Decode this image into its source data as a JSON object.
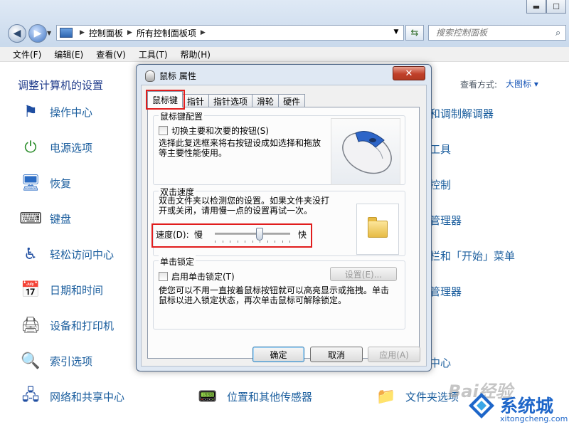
{
  "window": {
    "address": {
      "segments": [
        "控制面板",
        "所有控制面板项"
      ]
    },
    "search": {
      "placeholder": "搜索控制面板"
    },
    "caption": {
      "minimize": "▬",
      "maximize": "☐"
    }
  },
  "menu": [
    "文件(F)",
    "编辑(E)",
    "查看(V)",
    "工具(T)",
    "帮助(H)"
  ],
  "content": {
    "title": "调整计算机的设置",
    "view_label": "查看方式:",
    "view_value": "大图标 ▾",
    "left_items": [
      {
        "label": "操作中心",
        "icon": "flag-icon"
      },
      {
        "label": "电源选项",
        "icon": "power-icon"
      },
      {
        "label": "恢复",
        "icon": "recovery-icon"
      },
      {
        "label": "键盘",
        "icon": "keyboard-icon"
      },
      {
        "label": "轻松访问中心",
        "icon": "accessibility-icon"
      },
      {
        "label": "日期和时间",
        "icon": "calendar-icon"
      },
      {
        "label": "设备和打印机",
        "icon": "printer-icon"
      },
      {
        "label": "索引选项",
        "icon": "search-index-icon"
      },
      {
        "label": "网络和共享中心",
        "icon": "network-icon"
      }
    ],
    "bottom_mid_item": {
      "label": "位置和其他传感器",
      "icon": "sensor-icon"
    },
    "right_partial": [
      "和调制解调器",
      "工具",
      "控制",
      "管理器",
      "栏和「开始」菜单",
      "管理器",
      "中心"
    ],
    "bottom_right_item": {
      "label": "文件夹选项",
      "icon": "folder-options-icon"
    }
  },
  "dialog": {
    "title": "鼠标 属性",
    "close": "✕",
    "tabs": [
      "鼠标键",
      "指针",
      "指针选项",
      "滑轮",
      "硬件"
    ],
    "active_tab": "鼠标键",
    "button_config": {
      "legend": "鼠标键配置",
      "checkbox_label": "切换主要和次要的按钮(S)",
      "checked": false,
      "description": "选择此复选框来将右按钮设成如选择和拖放等主要性能使用。"
    },
    "double_click": {
      "legend": "双击速度",
      "description": "双击文件夹以检测您的设置。如果文件夹没打开或关闭，请用慢一点的设置再试一次。",
      "speed_label": "速度(D):",
      "slow": "慢",
      "fast": "快",
      "speed_fraction": 0.6
    },
    "click_lock": {
      "legend": "单击锁定",
      "checkbox_label": "启用单击锁定(T)",
      "checked": false,
      "settings_button": "设置(E)...",
      "description": "使您可以不用一直按着鼠标按钮就可以高亮显示或拖拽。单击鼠标以进入锁定状态，再次单击鼠标可解除锁定。"
    },
    "buttons": {
      "ok": "确定",
      "cancel": "取消",
      "apply": "应用(A)"
    }
  },
  "watermark": {
    "brand": "系统城",
    "url": "xitongcheng.com",
    "baidu": "Bai经验"
  },
  "colors": {
    "link": "#1b5e9e",
    "highlight": "#e11d1d",
    "title_blue": "#1e3a8a"
  }
}
